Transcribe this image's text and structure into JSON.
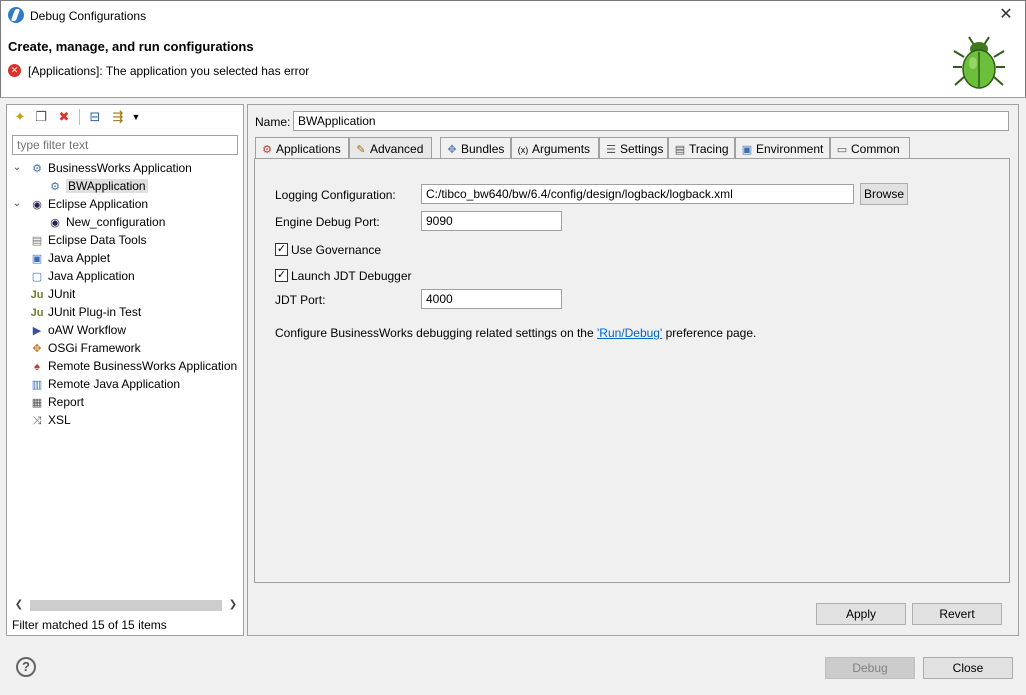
{
  "window": {
    "title": "Debug Configurations"
  },
  "header": {
    "title": "Create, manage, and run configurations",
    "message": "[Applications]: The application you selected has error"
  },
  "filter": {
    "placeholder": "type filter text"
  },
  "tree": [
    {
      "label": "BusinessWorks Application",
      "level": 0,
      "expanded": true,
      "icon": "bw-config-icon"
    },
    {
      "label": "BWApplication",
      "level": 1,
      "selected": true,
      "icon": "bw-app-icon"
    },
    {
      "label": "Eclipse Application",
      "level": 0,
      "expanded": true,
      "icon": "eclipse-icon"
    },
    {
      "label": "New_configuration",
      "level": 1,
      "icon": "eclipse-icon"
    },
    {
      "label": "Eclipse Data Tools",
      "level": 0,
      "icon": "database-icon"
    },
    {
      "label": "Java Applet",
      "level": 0,
      "icon": "applet-icon"
    },
    {
      "label": "Java Application",
      "level": 0,
      "icon": "java-app-icon"
    },
    {
      "label": "JUnit",
      "level": 0,
      "icon": "junit-icon"
    },
    {
      "label": "JUnit Plug-in Test",
      "level": 0,
      "icon": "junit-plugin-icon"
    },
    {
      "label": "oAW Workflow",
      "level": 0,
      "icon": "workflow-icon"
    },
    {
      "label": "OSGi Framework",
      "level": 0,
      "icon": "osgi-icon"
    },
    {
      "label": "Remote BusinessWorks Application",
      "level": 0,
      "icon": "remote-bw-icon"
    },
    {
      "label": "Remote Java Application",
      "level": 0,
      "icon": "remote-java-icon"
    },
    {
      "label": "Report",
      "level": 0,
      "icon": "report-icon"
    },
    {
      "label": "XSL",
      "level": 0,
      "icon": "xsl-icon"
    }
  ],
  "filter_status": "Filter matched 15 of 15 items",
  "config": {
    "name_label": "Name:",
    "name_value": "BWApplication"
  },
  "tabs": [
    {
      "label": "Applications",
      "icon": "applications-icon"
    },
    {
      "label": "Advanced",
      "icon": "advanced-icon",
      "active": true
    },
    {
      "label": "Bundles",
      "icon": "bundles-icon"
    },
    {
      "label": "Arguments",
      "icon": "arguments-icon"
    },
    {
      "label": "Settings",
      "icon": "settings-icon"
    },
    {
      "label": "Tracing",
      "icon": "tracing-icon"
    },
    {
      "label": "Environment",
      "icon": "environment-icon"
    },
    {
      "label": "Common",
      "icon": "common-icon"
    }
  ],
  "advanced": {
    "logging_label": "Logging Configuration:",
    "logging_value": "C:/tibco_bw640/bw/6.4/config/design/logback/logback.xml",
    "browse_label": "Browse",
    "engine_port_label": "Engine Debug Port:",
    "engine_port_value": "9090",
    "use_governance_label": "Use Governance",
    "use_governance_checked": true,
    "launch_jdt_label": "Launch JDT Debugger",
    "launch_jdt_checked": true,
    "jdt_port_label": "JDT Port:",
    "jdt_port_value": "4000",
    "info_prefix": "Configure BusinessWorks debugging related settings on the ",
    "info_link": "'Run/Debug'",
    "info_suffix": " preference page."
  },
  "buttons": {
    "apply": "Apply",
    "revert": "Revert",
    "debug": "Debug",
    "close": "Close"
  },
  "colors": {
    "link": "#0066cc",
    "error": "#d9342b"
  }
}
